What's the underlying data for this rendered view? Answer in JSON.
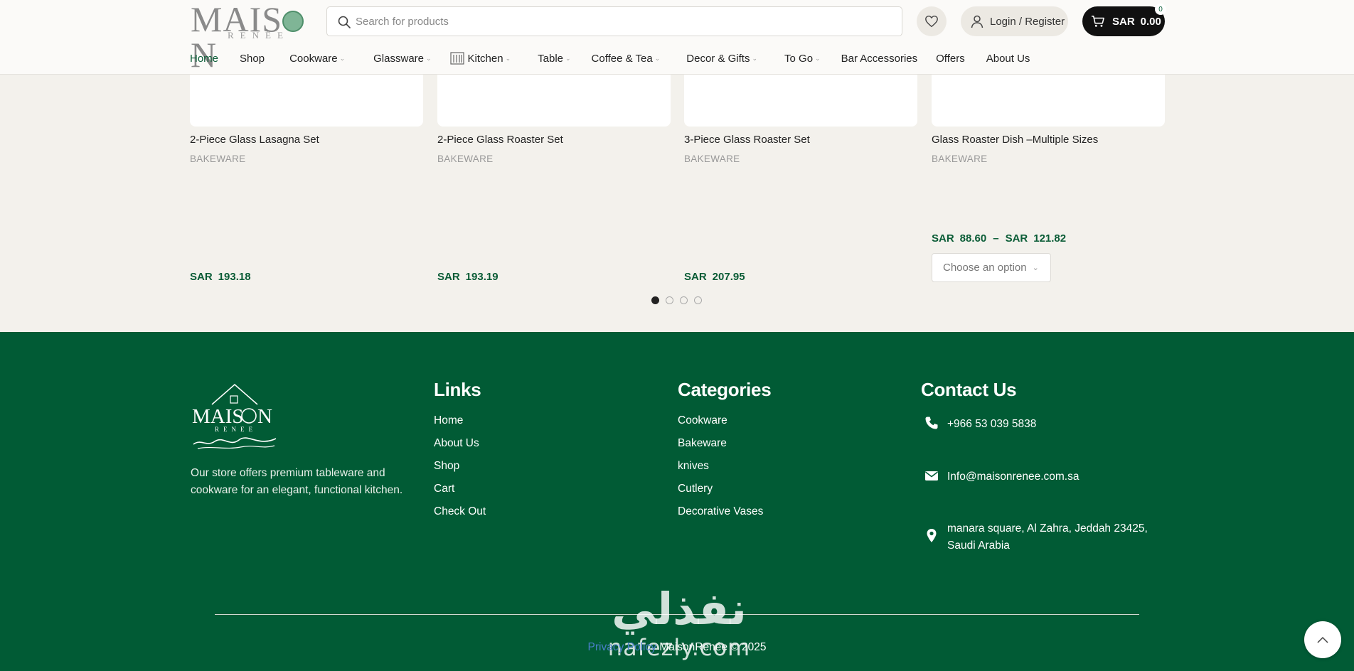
{
  "header": {
    "logo": {
      "text": "MAIS",
      "text_end": "N",
      "sub": "RENÉE"
    },
    "search": {
      "placeholder": "Search for products"
    },
    "login_label": "Login / Register",
    "cart": {
      "currency": "SAR",
      "amount": "0.00",
      "count": "0"
    }
  },
  "nav": {
    "items": [
      {
        "label": "Home",
        "active": true
      },
      {
        "label": "Shop"
      },
      {
        "label": "Cookware"
      },
      {
        "label": "Glassware"
      },
      {
        "label": "Kitchen"
      },
      {
        "label": "Table"
      },
      {
        "label": "Coffee & Tea"
      },
      {
        "label": "Decor & Gifts"
      },
      {
        "label": "To Go"
      },
      {
        "label": "Bar Accessories"
      },
      {
        "label": "Offers"
      },
      {
        "label": "About Us"
      }
    ],
    "caret": "⌄"
  },
  "products": [
    {
      "name": "2-Piece Glass Lasagna Set",
      "category": "BAKEWARE",
      "currency": "SAR",
      "price": "193.18"
    },
    {
      "name": "2-Piece Glass Roaster Set",
      "category": "BAKEWARE",
      "currency": "SAR",
      "price": "193.19"
    },
    {
      "name": "3-Piece Glass Roaster Set",
      "category": "BAKEWARE",
      "currency": "SAR",
      "price": "207.95"
    },
    {
      "name": "Glass Roaster Dish –Multiple Sizes",
      "category": "BAKEWARE",
      "currency": "SAR",
      "price_min": "88.60",
      "price_sep": "–",
      "price_max": "121.82",
      "option_label": "Choose an option"
    }
  ],
  "carousel": {
    "pages": 4,
    "active": 1
  },
  "footer": {
    "about": "Our store offers premium tableware and cookware for an elegant, functional kitchen.",
    "links": {
      "title": "Links",
      "items": [
        "Home",
        "About Us",
        "Shop",
        "Cart",
        "Check Out"
      ]
    },
    "categories": {
      "title": "Categories",
      "items": [
        "Cookware",
        "Bakeware",
        "knives",
        "Cutlery",
        "Decorative Vases"
      ]
    },
    "contact": {
      "title": "Contact Us",
      "phone": "+966 53 039 5838",
      "email": "Info@maisonrenee.com.sa",
      "address_line1": "manara square, Al Zahra, Jeddah 23425,",
      "address_line2": "Saudi Arabia"
    },
    "privacy": "Privacy Policy",
    "copyright": " MaisonRenée © 2025"
  },
  "watermark": {
    "arabic": "نفذلي",
    "latin": "nafezly.com"
  },
  "colors": {
    "brand_green": "#015b35",
    "price_green": "#0a5c36",
    "cart_bg": "#111111"
  }
}
